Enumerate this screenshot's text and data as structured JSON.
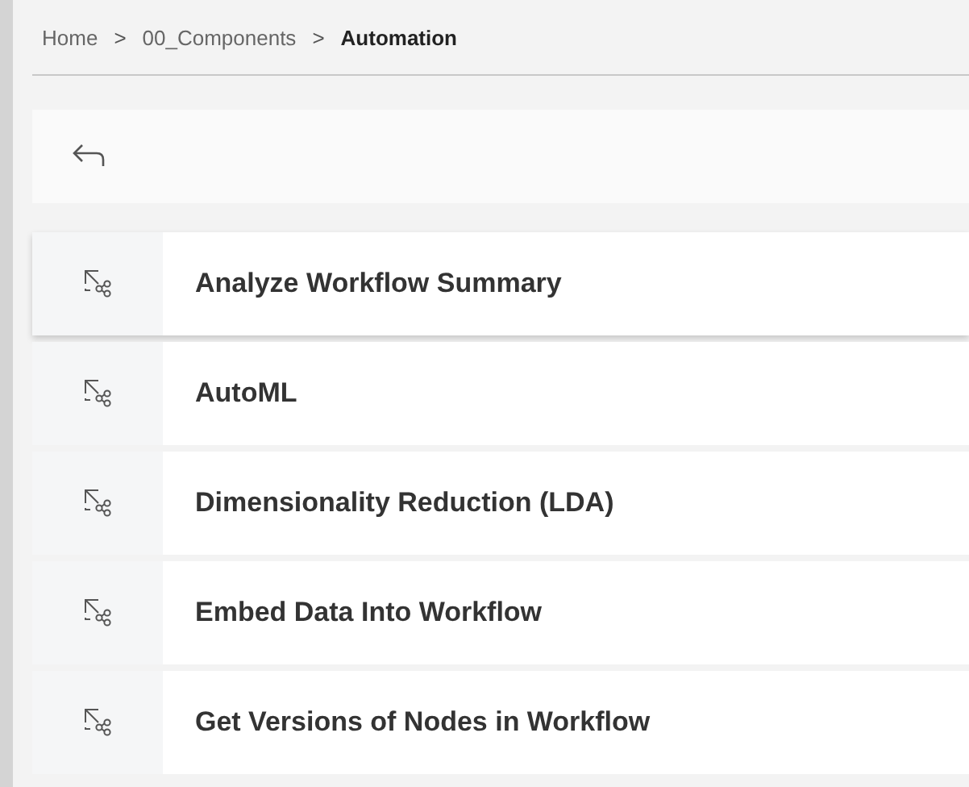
{
  "breadcrumb": [
    {
      "label": "Home",
      "current": false
    },
    {
      "label": "00_Components",
      "current": false
    },
    {
      "label": "Automation",
      "current": true
    }
  ],
  "separator": ">",
  "items": [
    {
      "label": "Analyze Workflow Summary",
      "selected": true
    },
    {
      "label": "AutoML",
      "selected": false
    },
    {
      "label": "Dimensionality Reduction (LDA)",
      "selected": false
    },
    {
      "label": "Embed Data Into Workflow",
      "selected": false
    },
    {
      "label": "Get Versions of Nodes in Workflow",
      "selected": false
    }
  ]
}
